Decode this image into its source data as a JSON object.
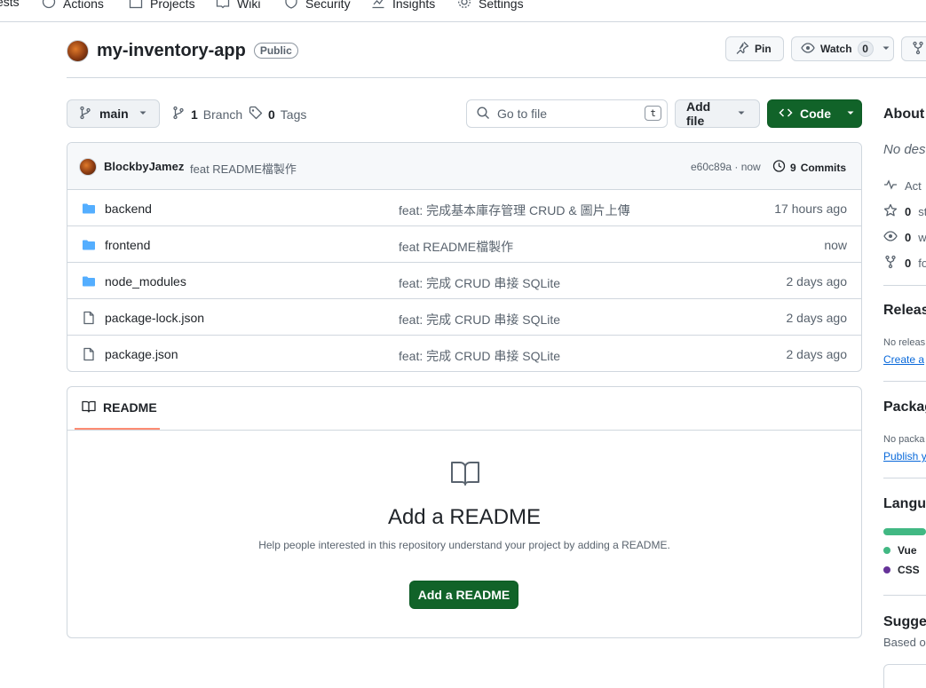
{
  "nav": {
    "items": [
      {
        "label": "ests"
      },
      {
        "label": "Actions"
      },
      {
        "label": "Projects"
      },
      {
        "label": "Wiki"
      },
      {
        "label": "Security"
      },
      {
        "label": "Insights"
      },
      {
        "label": "Settings"
      }
    ]
  },
  "repo": {
    "name": "my-inventory-app",
    "visibility": "Public",
    "pin_label": "Pin",
    "watch_label": "Watch",
    "watch_count": "0"
  },
  "toolbar": {
    "branch": "main",
    "branches_count": "1",
    "branches_label": "Branch",
    "tags_count": "0",
    "tags_label": "Tags",
    "search_placeholder": "Go to file",
    "search_shortcut": "t",
    "add_file_label": "Add file",
    "code_label": "Code"
  },
  "commit": {
    "author": "BlockbyJamez",
    "message": "feat README檔製作",
    "hash_time": "e60c89a · now",
    "commits_count": "9",
    "commits_label": "Commits"
  },
  "files": [
    {
      "type": "folder",
      "name": "backend",
      "message": "feat: 完成基本庫存管理 CRUD & 圖片上傳",
      "time": "17 hours ago"
    },
    {
      "type": "folder",
      "name": "frontend",
      "message": "feat README檔製作",
      "time": "now"
    },
    {
      "type": "folder",
      "name": "node_modules",
      "message": "feat: 完成 CRUD 串接 SQLite",
      "time": "2 days ago"
    },
    {
      "type": "file",
      "name": "package-lock.json",
      "message": "feat: 完成 CRUD 串接 SQLite",
      "time": "2 days ago"
    },
    {
      "type": "file",
      "name": "package.json",
      "message": "feat: 完成 CRUD 串接 SQLite",
      "time": "2 days ago"
    }
  ],
  "readme": {
    "tab_label": "README",
    "title": "Add a README",
    "subtitle": "Help people interested in this repository understand your project by adding a README.",
    "button_label": "Add a README"
  },
  "sidebar": {
    "about_heading": "About",
    "about_desc": "No des",
    "activity": "Act",
    "stars_count": "0",
    "stars_label": "st",
    "watching_count": "0",
    "watching_label": "w",
    "forks_count": "0",
    "forks_label": "fo",
    "releases_heading": "Releas",
    "releases_text": "No releas",
    "releases_link": "Create a",
    "packages_heading": "Packag",
    "packages_text": "No packa",
    "packages_link": "Publish y",
    "languages_heading": "Langua",
    "lang1": "Vue",
    "lang1_color": "#41b883",
    "lang2": "CSS",
    "lang2_color": "#663399",
    "suggested_heading": "Sugges",
    "suggested_text": "Based o"
  },
  "colors": {
    "primary_button": "#116329",
    "link": "#0969da",
    "folder": "#54aeff",
    "tab_underline": "#fd8c73"
  }
}
